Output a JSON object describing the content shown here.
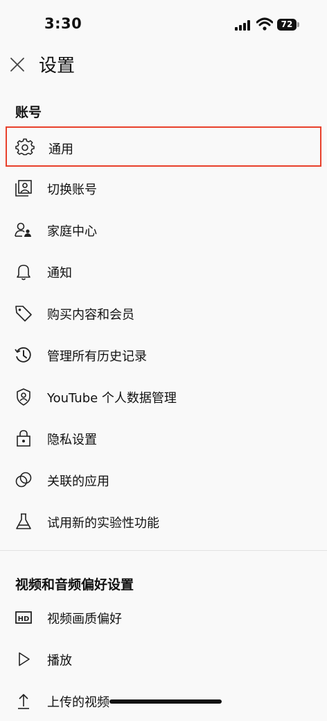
{
  "status_bar": {
    "time": "3:30",
    "battery": "72"
  },
  "header": {
    "title": "设置"
  },
  "sections": [
    {
      "title": "账号",
      "items": [
        {
          "label": "通用",
          "icon": "gear-icon"
        },
        {
          "label": "切换账号",
          "icon": "switch-account-icon"
        },
        {
          "label": "家庭中心",
          "icon": "family-icon"
        },
        {
          "label": "通知",
          "icon": "bell-icon"
        },
        {
          "label": "购买内容和会员",
          "icon": "tag-icon"
        },
        {
          "label": "管理所有历史记录",
          "icon": "history-icon"
        },
        {
          "label": "YouTube 个人数据管理",
          "icon": "shield-person-icon"
        },
        {
          "label": "隐私设置",
          "icon": "lock-icon"
        },
        {
          "label": "关联的应用",
          "icon": "linked-apps-icon"
        },
        {
          "label": "试用新的实验性功能",
          "icon": "flask-icon"
        }
      ]
    },
    {
      "title": "视频和音频偏好设置",
      "items": [
        {
          "label": "视频画质偏好",
          "icon": "hd-icon"
        },
        {
          "label": "播放",
          "icon": "play-icon"
        },
        {
          "label": "上传的视频",
          "icon": "upload-icon"
        }
      ]
    }
  ],
  "colors": {
    "highlight": "#e8402b",
    "text": "#111111",
    "background": "#f9f9f9"
  }
}
